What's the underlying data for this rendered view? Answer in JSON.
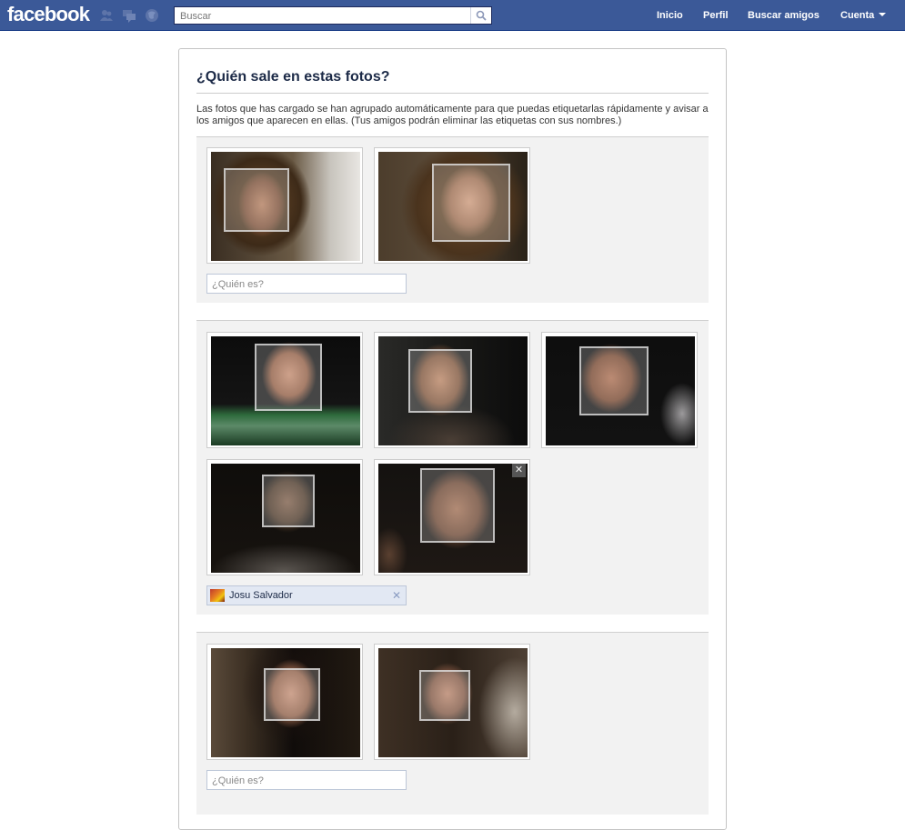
{
  "header": {
    "logo": "facebook",
    "search": {
      "placeholder": "Buscar"
    },
    "nav": {
      "home": "Inicio",
      "profile": "Perfil",
      "find_friends": "Buscar amigos",
      "account": "Cuenta"
    },
    "icons": [
      "friend-requests-icon",
      "messages-icon",
      "notifications-icon",
      "search-icon"
    ],
    "colors": {
      "bar": "#3b5998",
      "link_dark": "#1c2a47"
    }
  },
  "page": {
    "title": "¿Quién sale en estas fotos?",
    "intro": "Las fotos que has cargado se han agrupado automáticamente para que puedas etiquetarlas rápidamente y avisar a los amigos que aparecen en ellas. (Tus amigos podrán eliminar las etiquetas con sus nombres.)"
  },
  "groups": [
    {
      "photo_count": 2,
      "who_input": {
        "placeholder": "¿Quién es?",
        "value": ""
      }
    },
    {
      "photo_count": 5,
      "tag": {
        "name": "Josu Salvador",
        "remove_icon": "close-icon"
      },
      "photo_remove_icon": "close-icon"
    },
    {
      "photo_count": 2,
      "who_input": {
        "placeholder": "¿Quién es?",
        "value": ""
      }
    }
  ]
}
